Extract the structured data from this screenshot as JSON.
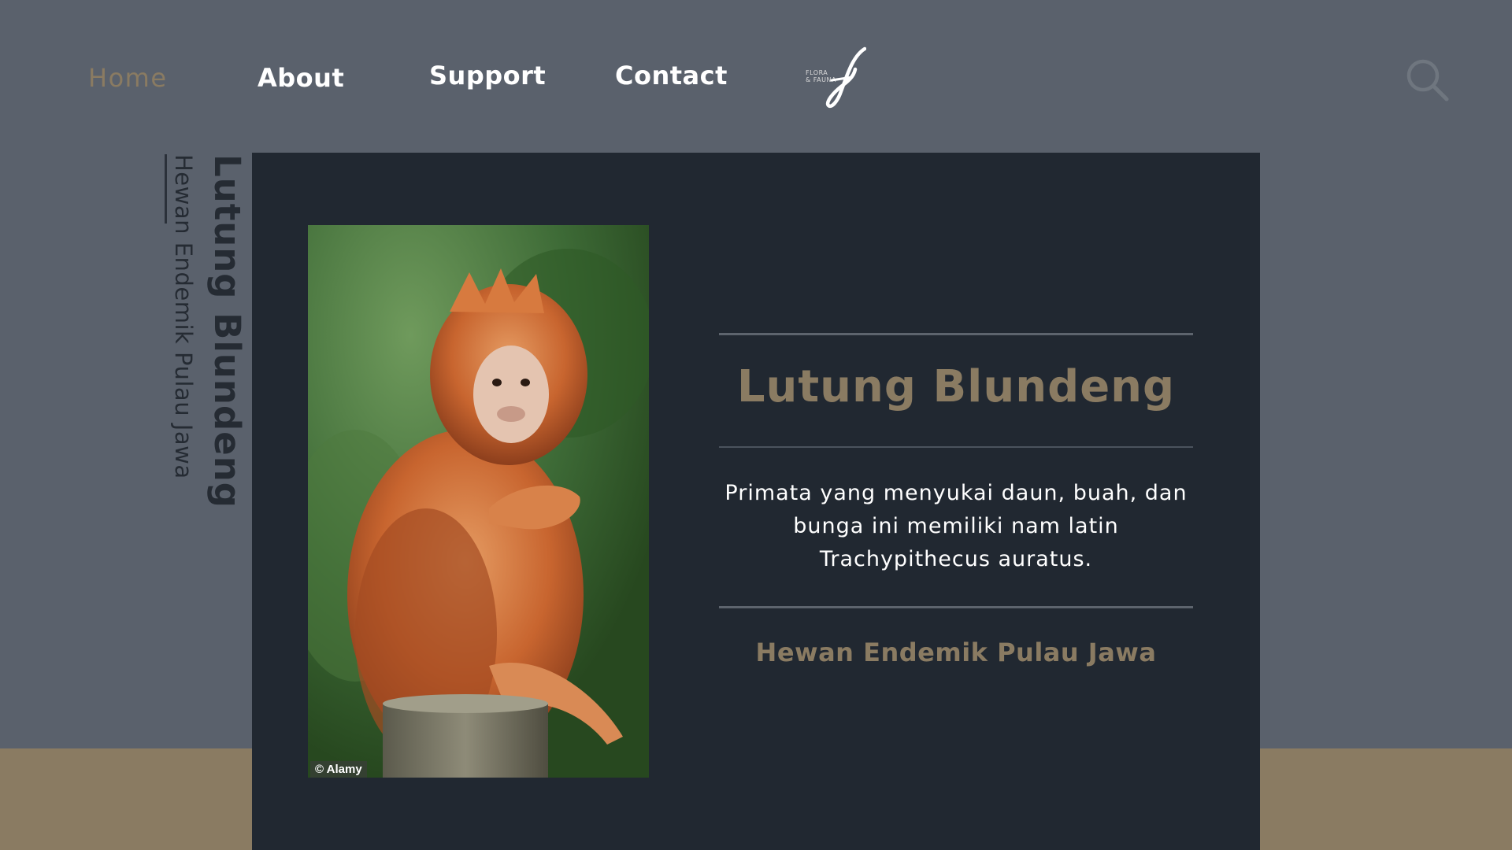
{
  "nav": {
    "home": "Home",
    "about": "About",
    "support": "Support",
    "contact": "Contact"
  },
  "logo": {
    "line1": "FLORA",
    "line2": "& FAUNA"
  },
  "side": {
    "title": "Lutung Blundeng",
    "subtitle": "Hewan Endemik Pulau Jawa"
  },
  "card": {
    "title": "Lutung Blundeng",
    "description": "Primata yang menyukai daun, buah, dan bunga ini memiliki nam latin Trachypithecus auratus.",
    "subtitle": "Hewan Endemik Pulau Jawa",
    "photo_credit": "© Alamy"
  },
  "colors": {
    "background": "#5a616c",
    "card": "#212831",
    "accent": "#8a7b62"
  },
  "icons": {
    "search": "search-icon",
    "logo": "flora-fauna-logo"
  }
}
